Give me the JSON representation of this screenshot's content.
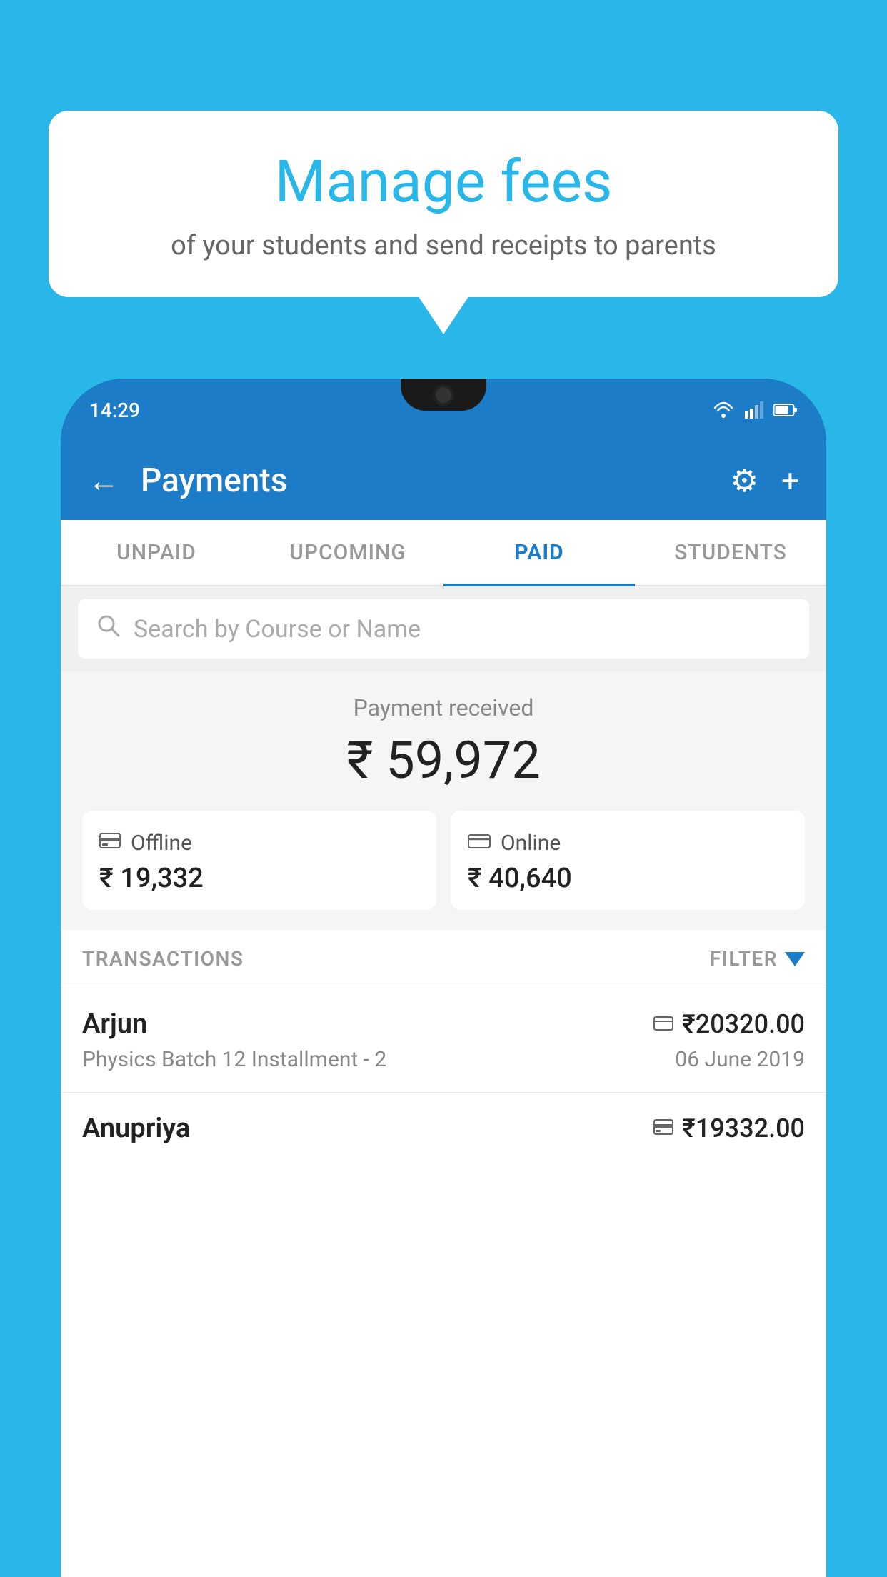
{
  "background_color": "#29b6e8",
  "speech_bubble": {
    "title": "Manage fees",
    "subtitle": "of your students and send receipts to parents"
  },
  "status_bar": {
    "time": "14:29",
    "wifi": true,
    "signal": true,
    "battery": true
  },
  "app_header": {
    "title": "Payments",
    "back_label": "←",
    "settings_label": "⚙",
    "add_label": "+"
  },
  "tabs": [
    {
      "label": "UNPAID",
      "active": false
    },
    {
      "label": "UPCOMING",
      "active": false
    },
    {
      "label": "PAID",
      "active": true
    },
    {
      "label": "STUDENTS",
      "active": false
    }
  ],
  "search": {
    "placeholder": "Search by Course or Name"
  },
  "payment_summary": {
    "label": "Payment received",
    "total": "₹ 59,972",
    "offline": {
      "type": "Offline",
      "amount": "₹ 19,332"
    },
    "online": {
      "type": "Online",
      "amount": "₹ 40,640"
    }
  },
  "transactions": {
    "header_label": "TRANSACTIONS",
    "filter_label": "FILTER",
    "items": [
      {
        "name": "Arjun",
        "course": "Physics Batch 12 Installment - 2",
        "amount": "₹20320.00",
        "date": "06 June 2019",
        "type": "online"
      },
      {
        "name": "Anupriya",
        "course": "",
        "amount": "₹19332.00",
        "date": "",
        "type": "offline"
      }
    ]
  }
}
